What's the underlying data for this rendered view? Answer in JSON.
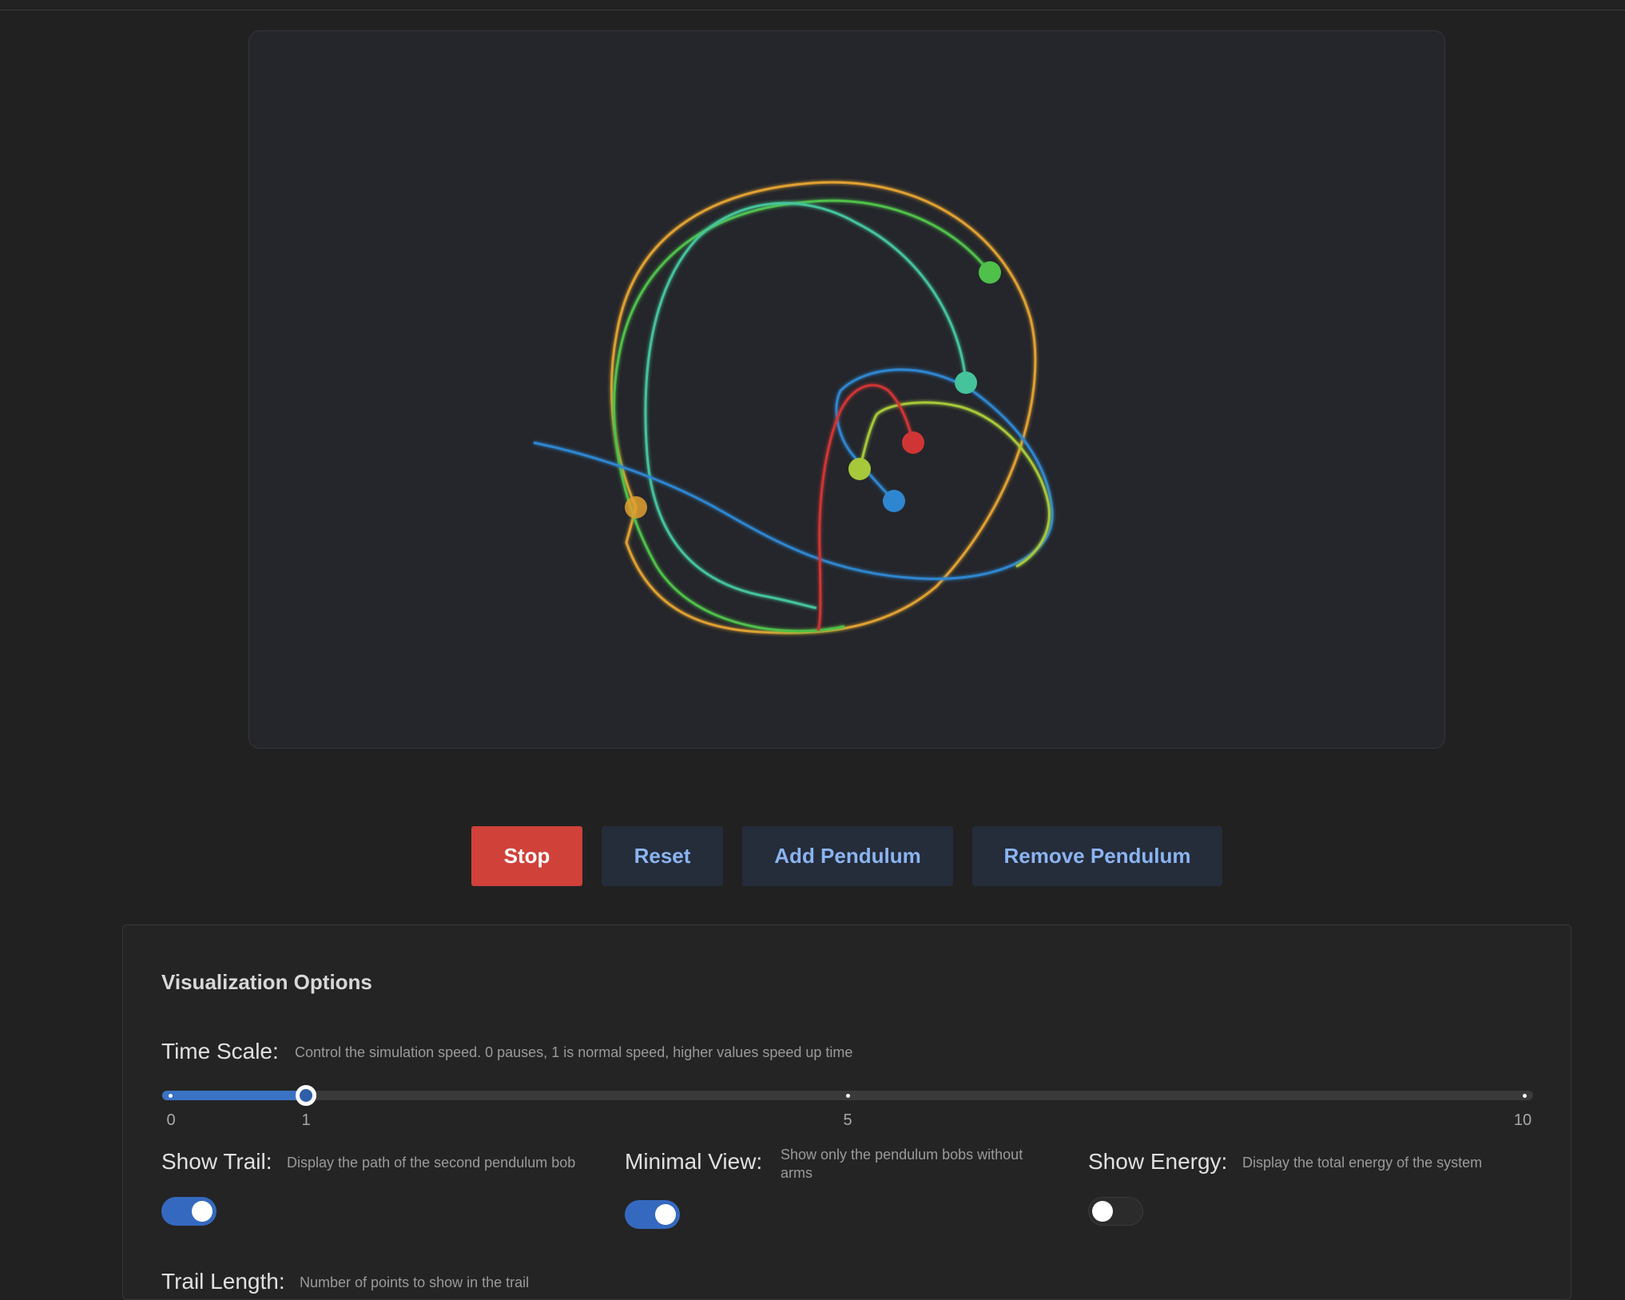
{
  "controls": {
    "stop_label": "Stop",
    "reset_label": "Reset",
    "add_label": "Add Pendulum",
    "remove_label": "Remove Pendulum"
  },
  "panel": {
    "title": "Visualization Options",
    "time_scale": {
      "label": "Time Scale:",
      "description": "Control the simulation speed. 0 pauses, 1 is normal speed, higher values speed up time",
      "value": 1,
      "min": 0,
      "max": 10,
      "tick_labels": [
        "0",
        "1",
        "5",
        "10"
      ]
    },
    "show_trail": {
      "label": "Show Trail:",
      "description": "Display the path of the second pendulum bob",
      "enabled": true
    },
    "minimal_view": {
      "label": "Minimal View:",
      "description": "Show only the pendulum bobs without arms",
      "enabled": true
    },
    "show_energy": {
      "label": "Show Energy:",
      "description": "Display the total energy of the system",
      "enabled": false
    },
    "trail_length": {
      "label": "Trail Length:",
      "description": "Number of points to show in the trail"
    }
  },
  "simulation": {
    "pendulum_colors": [
      "#e0a030",
      "#4fc04a",
      "#45c39a",
      "#2f86d0",
      "#a6c83a",
      "#d03535"
    ]
  }
}
